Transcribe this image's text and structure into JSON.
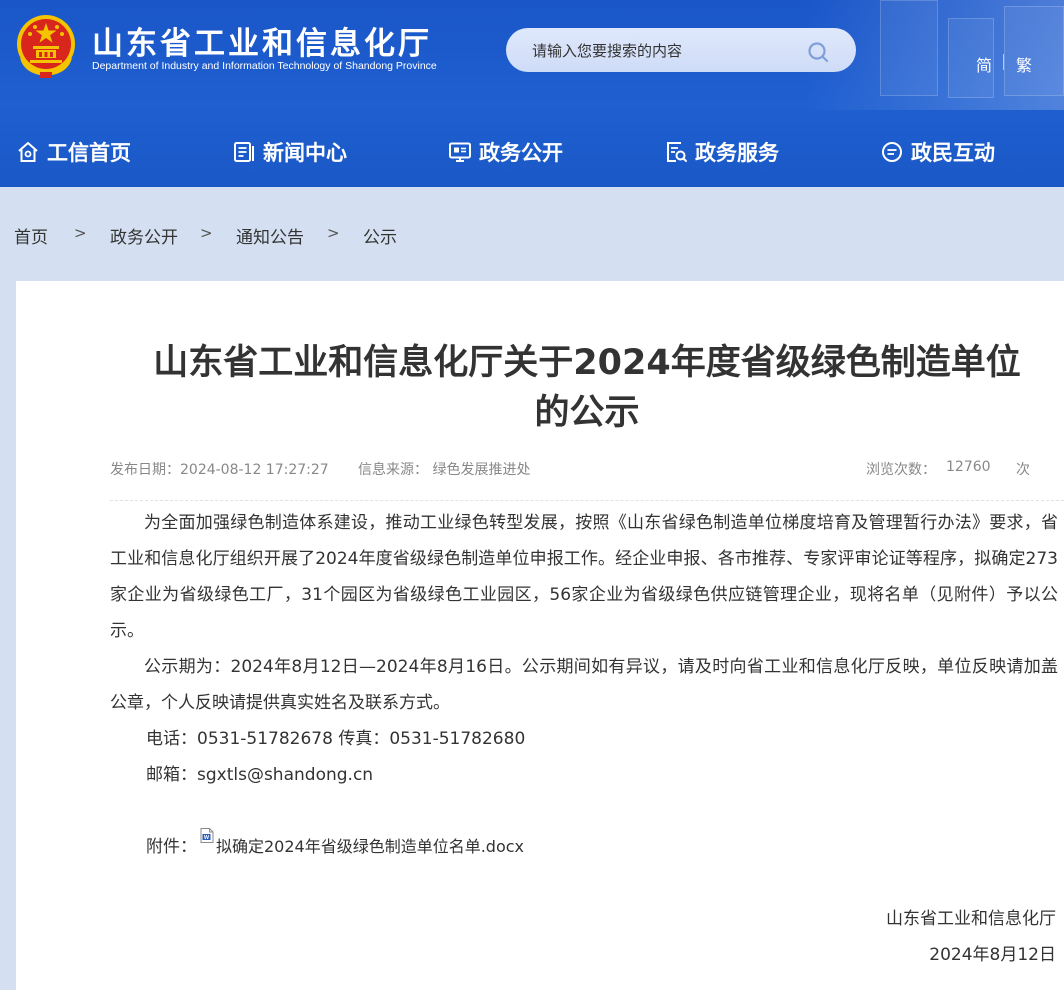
{
  "header": {
    "site_title": "山东省工业和信息化厅",
    "site_subtitle": "Department of Industry and Information Technology of Shandong Province",
    "search_placeholder": "请输入您要搜索的内容",
    "lang_simplified": "简",
    "lang_traditional": "繁"
  },
  "nav": [
    {
      "label": "工信首页",
      "icon": "home-icon"
    },
    {
      "label": "新闻中心",
      "icon": "news-icon"
    },
    {
      "label": "政务公开",
      "icon": "monitor-icon"
    },
    {
      "label": "政务服务",
      "icon": "service-icon"
    },
    {
      "label": "政民互动",
      "icon": "chat-icon"
    }
  ],
  "breadcrumb": {
    "items": [
      "首页",
      "政务公开",
      "通知公告",
      "公示"
    ],
    "separator": ">"
  },
  "article": {
    "title_line1": "山东省工业和信息化厅关于2024年度省级绿色制造单位",
    "title_line2": "的公示",
    "publish_date": "发布日期：2024-08-12 17:27:27",
    "source": "信息来源： 绿色发展推进处",
    "views_label": "浏览次数：",
    "views_count": "12760",
    "views_unit": "次",
    "paragraph1": "为全面加强绿色制造体系建设，推动工业绿色转型发展，按照《山东省绿色制造单位梯度培育及管理暂行办法》要求，省工业和信息化厅组织开展了2024年度省级绿色制造单位申报工作。经企业申报、各市推荐、专家评审论证等程序，拟确定273家企业为省级绿色工厂，31个园区为省级绿色工业园区，56家企业为省级绿色供应链管理企业，现将名单（见附件）予以公示。",
    "paragraph2": "公示期为：2024年8月12日—2024年8月16日。公示期间如有异议，请及时向省工业和信息化厅反映，单位反映请加盖公章，个人反映请提供真实姓名及联系方式。",
    "contact_line": "电话：0531-51782678  传真：0531-51782680",
    "email_line": "邮箱：sgxtls@shandong.cn",
    "attachment_label": "附件：",
    "attachment_name": "拟确定2024年省级绿色制造单位名单.docx",
    "signature_org": "山东省工业和信息化厅",
    "signature_date": "2024年8月12日"
  },
  "colors": {
    "header_blue": "#1f5fd0",
    "page_bg": "#d4e0f1",
    "emblem_red": "#d9261c",
    "emblem_gold": "#f5c400"
  }
}
